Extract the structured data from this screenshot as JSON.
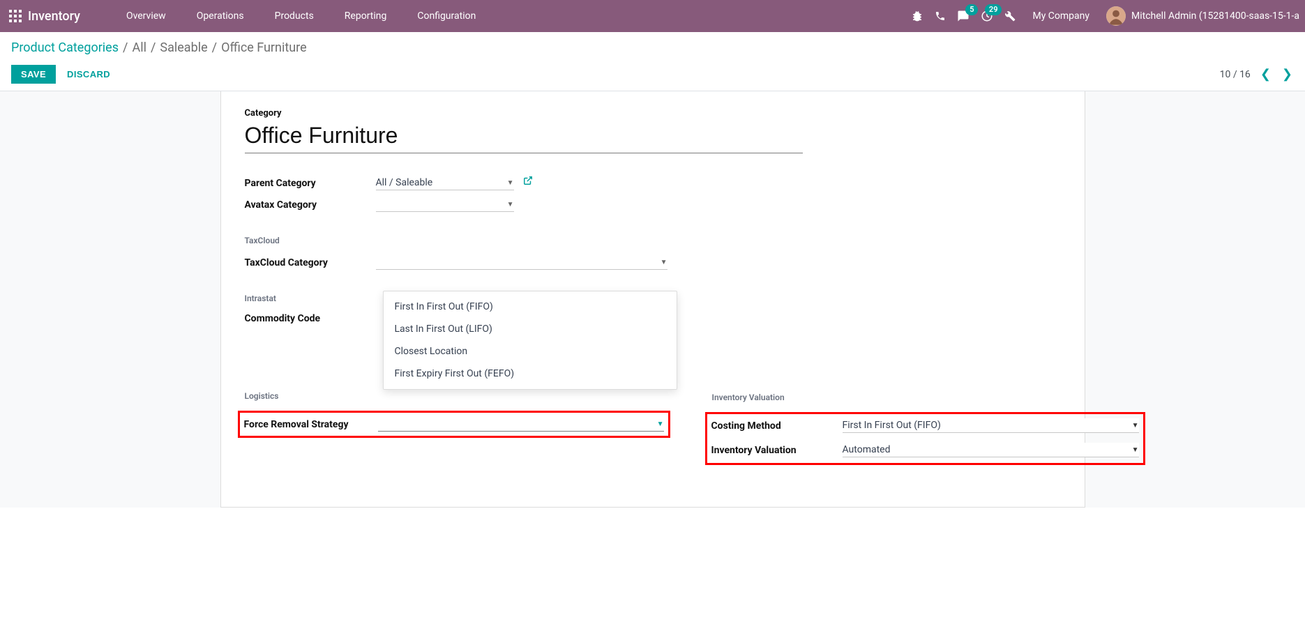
{
  "header": {
    "app_title": "Inventory",
    "nav": [
      "Overview",
      "Operations",
      "Products",
      "Reporting",
      "Configuration"
    ],
    "msg_badge": "5",
    "activity_badge": "29",
    "company": "My Company",
    "user": "Mitchell Admin (15281400-saas-15-1-a"
  },
  "breadcrumb": {
    "root": "Product Categories",
    "sep": "/",
    "p1": "All",
    "p2": "Saleable",
    "last": "Office Furniture"
  },
  "actions": {
    "save": "SAVE",
    "discard": "DISCARD"
  },
  "pager": {
    "text": "10 / 16"
  },
  "form": {
    "category_label": "Category",
    "category_name": "Office Furniture",
    "parent_label": "Parent Category",
    "parent_value": "All / Saleable",
    "avatax_label": "Avatax Category",
    "avatax_value": "",
    "taxcloud_section": "TaxCloud",
    "taxcloud_label": "TaxCloud Category",
    "taxcloud_value": "",
    "intrastat_section": "Intrastat",
    "commodity_label": "Commodity Code",
    "commodity_value": "",
    "logistics_section": "Logistics",
    "force_removal_label": "Force Removal Strategy",
    "force_removal_value": "",
    "removal_options": [
      "First In First Out (FIFO)",
      "Last In First Out (LIFO)",
      "Closest Location",
      "First Expiry First Out (FEFO)"
    ],
    "inv_val_section": "Inventory Valuation",
    "costing_label": "Costing Method",
    "costing_value": "First In First Out (FIFO)",
    "inv_val_label": "Inventory Valuation",
    "inv_val_value": "Automated"
  }
}
